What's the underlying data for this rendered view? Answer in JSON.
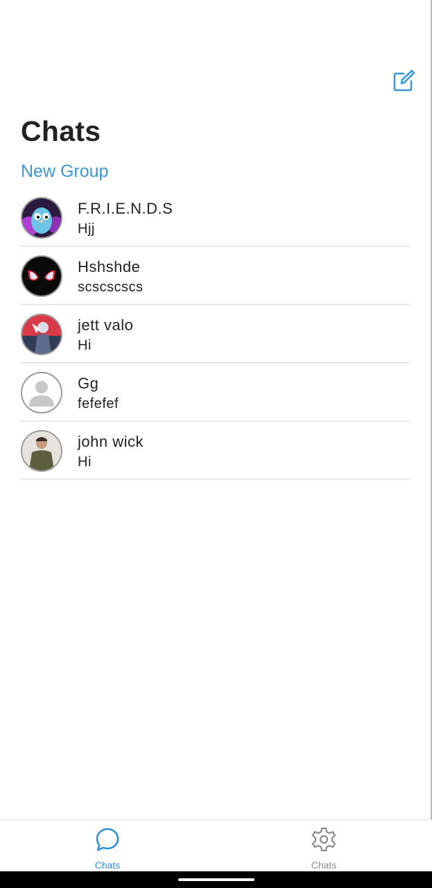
{
  "header": {
    "title": "Chats",
    "new_group": "New Group",
    "compose_icon": "compose-icon"
  },
  "chats": [
    {
      "name": "F.R.I.E.N.D.S",
      "last_message": "Hjj",
      "avatar": "gopher-avatar"
    },
    {
      "name": "Hshshde",
      "last_message": "scscscscs",
      "avatar": "spider-mask-avatar"
    },
    {
      "name": "jett valo",
      "last_message": "Hi",
      "avatar": "character-art-avatar"
    },
    {
      "name": "Gg",
      "last_message": "fefefef",
      "avatar": "default-person-avatar"
    },
    {
      "name": "john wick",
      "last_message": "Hi",
      "avatar": "photo-avatar"
    }
  ],
  "bottom_nav": {
    "tabs": [
      {
        "label": "Chats",
        "icon": "chat-bubble-icon",
        "active": true
      },
      {
        "label": "Chats",
        "icon": "gear-icon",
        "active": false
      }
    ],
    "active_color": "#2f8fd6",
    "inactive_color": "#8a8a8a"
  }
}
